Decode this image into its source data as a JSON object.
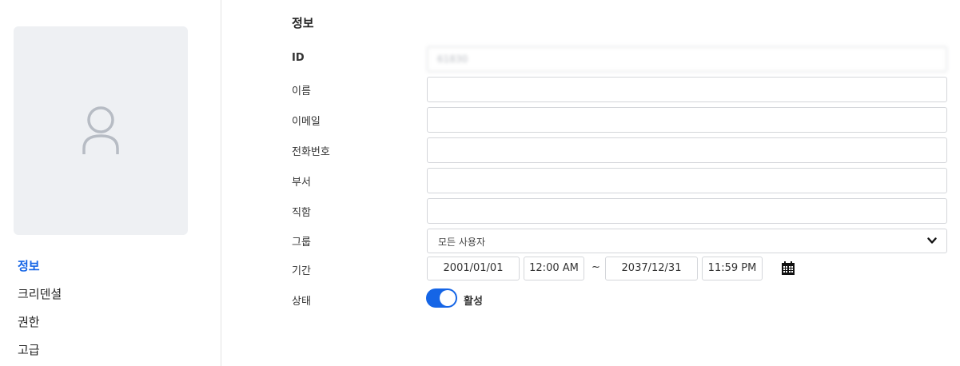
{
  "sidebar": {
    "items": [
      {
        "label": "정보",
        "active": true
      },
      {
        "label": "크리덴셜",
        "active": false
      },
      {
        "label": "권한",
        "active": false
      },
      {
        "label": "고급",
        "active": false
      }
    ]
  },
  "info": {
    "title": "정보",
    "id_label": "ID",
    "id_value": "61830",
    "name_label": "이름",
    "name_value": "",
    "email_label": "이메일",
    "email_value": "",
    "phone_label": "전화번호",
    "phone_value": "",
    "department_label": "부서",
    "department_value": "",
    "position_label": "직함",
    "position_value": "",
    "group_label": "그룹",
    "group_value": "모든 사용자",
    "period_label": "기간",
    "period": {
      "start_date": "2001/01/01",
      "start_time": "12:00 AM",
      "separator": "~",
      "end_date": "2037/12/31",
      "end_time": "11:59 PM"
    },
    "status_label": "상태",
    "status_value": "활성",
    "status_on": true
  },
  "colors": {
    "accent": "#1565e6",
    "avatar_bg": "#eef0f3",
    "avatar_icon": "#b7bcc4",
    "border": "#d4d6da"
  },
  "icons": {
    "avatar": "user-outline-icon",
    "dropdown": "chevron-down-icon",
    "calendar": "calendar-icon"
  }
}
